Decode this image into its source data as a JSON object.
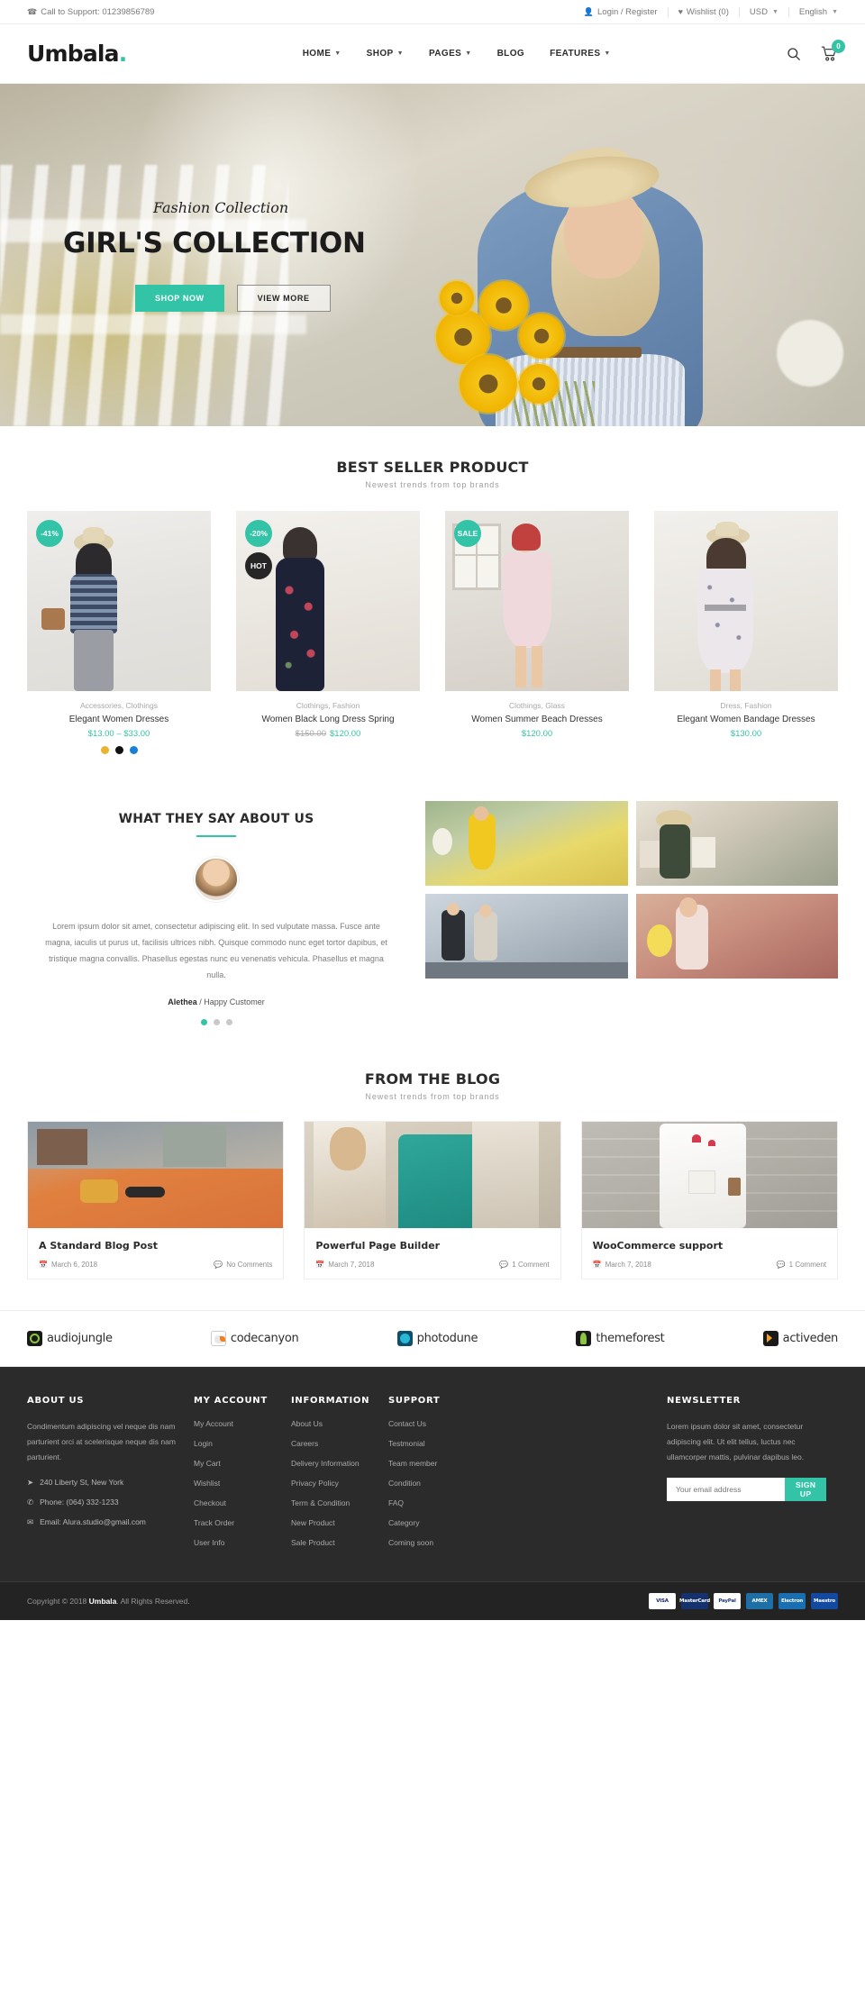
{
  "topbar": {
    "support_label": "Call to Support: 01239856789",
    "phone_icon": "phone-icon",
    "login": "Login / Register",
    "login_icon": "user-icon",
    "wishlist": "Wishlist (0)",
    "wishlist_icon": "heart-icon",
    "currency": "USD",
    "language": "English"
  },
  "header": {
    "logo": "Umbala",
    "logo_dot": ".",
    "nav": [
      {
        "label": "HOME",
        "caret": true
      },
      {
        "label": "SHOP",
        "caret": true
      },
      {
        "label": "PAGES",
        "caret": true
      },
      {
        "label": "BLOG",
        "caret": false
      },
      {
        "label": "FEATURES",
        "caret": true
      }
    ],
    "search_icon": "search-icon",
    "cart_icon": "cart-icon",
    "cart_count": "0"
  },
  "hero": {
    "eyebrow": "Fashion Collection",
    "title": "GIRL'S COLLECTION",
    "primary_btn": "SHOP NOW",
    "secondary_btn": "VIEW MORE"
  },
  "best_seller": {
    "title": "BEST SELLER PRODUCT",
    "subtitle": "Newest trends from top brands",
    "products": [
      {
        "badges": [
          {
            "text": "-41%",
            "style": "teal"
          }
        ],
        "category": "Accessories, Clothings",
        "name": "Elegant Women Dresses",
        "price": "$13.00 – $33.00",
        "old_price": "",
        "swatches": [
          "#e8b430",
          "#111111",
          "#1b7fd4"
        ]
      },
      {
        "badges": [
          {
            "text": "-20%",
            "style": "teal"
          },
          {
            "text": "HOT",
            "style": "dark"
          }
        ],
        "category": "Clothings, Fashion",
        "name": "Women Black Long Dress Spring",
        "price": "$120.00",
        "old_price": "$150.00",
        "swatches": []
      },
      {
        "badges": [
          {
            "text": "SALE",
            "style": "sale"
          }
        ],
        "category": "Clothings, Glass",
        "name": "Women Summer Beach Dresses",
        "price": "$120.00",
        "old_price": "",
        "swatches": []
      },
      {
        "badges": [],
        "category": "Dress, Fashion",
        "name": "Elegant Women Bandage Dresses",
        "price": "$130.00",
        "old_price": "",
        "swatches": []
      }
    ]
  },
  "testimonial": {
    "title": "WHAT THEY SAY ABOUT US",
    "avatar": "customer-avatar",
    "quote": "Lorem ipsum dolor sit amet, consectetur adipiscing elit. In sed vulputate massa. Fusce ante magna, iaculis ut purus ut, facilisis ultrices nibh. Quisque commodo nunc eget tortor dapibus, et tristique magna convallis. Phasellus egestas nunc eu venenatis vehicula. Phasellus et magna nulla.",
    "author_name": "Alethea",
    "author_role": "Happy Customer",
    "dots": 3,
    "active_dot": 0
  },
  "blog": {
    "title": "FROM THE BLOG",
    "subtitle": "Newest trends from top brands",
    "posts": [
      {
        "title": "A Standard Blog Post",
        "date": "March 6, 2018",
        "comments": "No Comments"
      },
      {
        "title": "Powerful Page Builder",
        "date": "March 7, 2018",
        "comments": "1 Comment"
      },
      {
        "title": "WooCommerce support",
        "date": "March 7, 2018",
        "comments": "1 Comment"
      }
    ]
  },
  "brands": [
    {
      "name": "audiojungle",
      "color": "#1a1a1a"
    },
    {
      "name": "codecanyon",
      "color": "#ffffff"
    },
    {
      "name": "photodune",
      "color": "#0e4f6e"
    },
    {
      "name": "themeforest",
      "color": "#1a1a1a"
    },
    {
      "name": "activeden",
      "color": "#1a1a1a"
    }
  ],
  "footer": {
    "about": {
      "heading": "ABOUT US",
      "text": "Condimentum adipiscing vel neque dis nam parturient orci at scelerisque neque dis nam parturient.",
      "address": "240 Liberty St, New York",
      "address_icon": "location-icon",
      "phone": "Phone: (064) 332-1233",
      "phone_icon": "mobile-icon",
      "email": "Email: Alura.studio@gmail.com",
      "email_icon": "envelope-icon"
    },
    "my_account": {
      "heading": "MY ACCOUNT",
      "items": [
        "My Account",
        "Login",
        "My Cart",
        "Wishlist",
        "Checkout",
        "Track Order",
        "User Info"
      ]
    },
    "information": {
      "heading": "INFORMATION",
      "items": [
        "About Us",
        "Careers",
        "Delivery Information",
        "Privacy Policy",
        "Term & Condition",
        "New Product",
        "Sale Product"
      ]
    },
    "support": {
      "heading": "SUPPORT",
      "items": [
        "Contact Us",
        "Testmonial",
        "Team member",
        "Condition",
        "FAQ",
        "Category",
        "Coming soon"
      ]
    },
    "newsletter": {
      "heading": "NEWSLETTER",
      "text": "Lorem ipsum dolor sit amet, consectetur adipiscing elit. Ut elit tellus, luctus nec ullamcorper mattis, pulvinar dapibus leo.",
      "placeholder": "Your email address",
      "value": "",
      "button": "SIGN UP"
    },
    "copyright_prefix": "Copyright © 2018 ",
    "copyright_brand": "Umbala",
    "copyright_suffix": ". All Rights Reserved.",
    "payments": [
      {
        "name": "VISA",
        "label": "VISA",
        "bg": "#ffffff",
        "fg": "#1a1f71"
      },
      {
        "name": "MasterCard",
        "label": "MasterCard",
        "bg": "#16326c",
        "fg": "#ffffff"
      },
      {
        "name": "PayPal",
        "label": "PayPal",
        "bg": "#ffffff",
        "fg": "#1b3a7a"
      },
      {
        "name": "American Express",
        "label": "AMEX",
        "bg": "#1d6fa5",
        "fg": "#ffffff"
      },
      {
        "name": "Visa Electron",
        "label": "Electron",
        "bg": "#1a6fb0",
        "fg": "#ffffff"
      },
      {
        "name": "Maestro",
        "label": "Maestro",
        "bg": "#1449a0",
        "fg": "#ffffff"
      }
    ]
  },
  "accent": "#33c3a6"
}
